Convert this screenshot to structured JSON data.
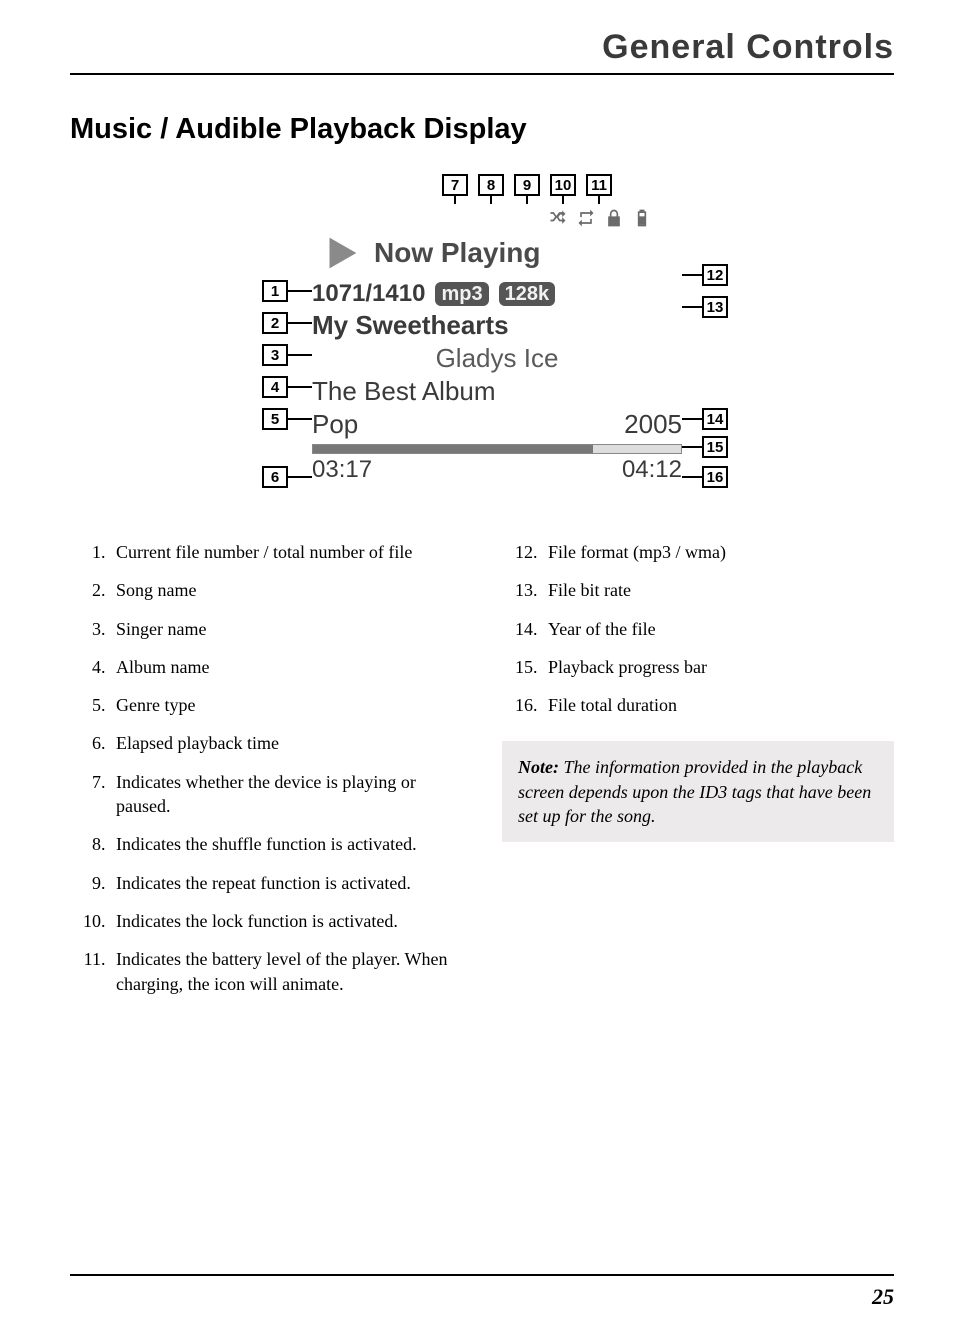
{
  "header": {
    "title": "General Controls"
  },
  "section": {
    "title": "Music / Audible Playback Display"
  },
  "lcd": {
    "now_playing": "Now Playing",
    "counter": "1071/1410",
    "format_pill": "mp3",
    "bitrate_pill": "128k",
    "song": "My Sweethearts",
    "artist": "Gladys Ice",
    "album": "The Best Album",
    "genre": "Pop",
    "year": "2005",
    "elapsed": "03:17",
    "total": "04:12"
  },
  "callouts": {
    "c1": "1",
    "c2": "2",
    "c3": "3",
    "c4": "4",
    "c5": "5",
    "c6": "6",
    "c7": "7",
    "c8": "8",
    "c9": "9",
    "c10": "10",
    "c11": "11",
    "c12": "12",
    "c13": "13",
    "c14": "14",
    "c15": "15",
    "c16": "16"
  },
  "left_list": [
    "Current file number / total number of file",
    "Song name",
    "Singer name",
    "Album name",
    "Genre type",
    "Elapsed playback time",
    "Indicates whether the device is playing or paused.",
    "Indicates the shuffle function is activated.",
    "Indicates the repeat function is activated.",
    "Indicates the lock function is activated.",
    "Indicates the battery level of the player. When charging, the icon will animate."
  ],
  "right_list": [
    "File format (mp3 / wma)",
    "File bit rate",
    "Year of the file",
    "Playback progress bar",
    "File total duration"
  ],
  "note": {
    "label": "Note:",
    "text": " The information provided in the playback screen depends upon the ID3 tags that have been set up for the song."
  },
  "page_number": "25"
}
